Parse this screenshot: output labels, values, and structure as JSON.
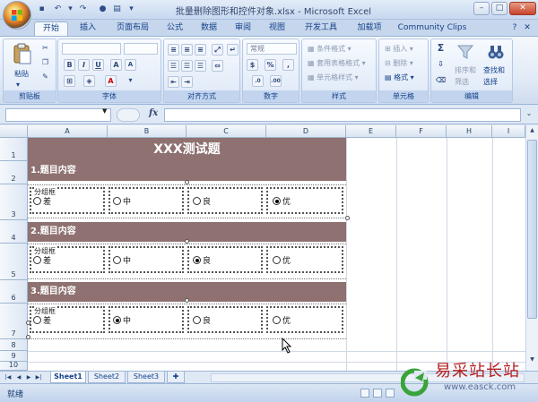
{
  "window": {
    "title": "批量删除图形和控件对象.xlsx - Microsoft Excel",
    "minimize_glyph": "–",
    "maximize_glyph": "□",
    "close_glyph": "✕"
  },
  "ribbon_tabs": [
    "开始",
    "插入",
    "页面布局",
    "公式",
    "数据",
    "审阅",
    "视图",
    "开发工具",
    "加载项",
    "Community Clips"
  ],
  "active_tab": "开始",
  "ribbon": {
    "clipboard": {
      "label": "剪贴板",
      "paste": "粘贴"
    },
    "font": {
      "label": "字体",
      "bold": "B",
      "italic": "I",
      "underline": "U",
      "font_color_glyph": "A"
    },
    "alignment": {
      "label": "对齐方式"
    },
    "number": {
      "label": "数字",
      "format_value": "常规",
      "percent": "%",
      "comma": ","
    },
    "styles": {
      "label": "样式",
      "conditional": "条件格式",
      "table": "套用表格格式",
      "cell_styles": "单元格样式"
    },
    "cells": {
      "label": "单元格",
      "insert": "插入",
      "delete": "删除",
      "format": "格式"
    },
    "editing": {
      "label": "编辑",
      "sum_glyph": "Σ",
      "sort_filter_1": "排序和",
      "sort_filter_2": "筛选",
      "find_select_1": "查找和",
      "find_select_2": "选择"
    }
  },
  "formula_bar": {
    "name_box": "",
    "fx": "fx",
    "formula": ""
  },
  "columns": [
    "A",
    "B",
    "C",
    "D",
    "E",
    "F",
    "H",
    "I"
  ],
  "rows": [
    "1",
    "2",
    "3",
    "4",
    "5",
    "6",
    "7",
    "8",
    "9",
    "10"
  ],
  "sheet": {
    "title": "XXX测试题",
    "questions": [
      {
        "header": "1.题目内容",
        "group_label": "分组框",
        "options": [
          "差",
          "中",
          "良",
          "优"
        ],
        "selected": 3
      },
      {
        "header": "2.题目内容",
        "group_label": "分组框",
        "options": [
          "差",
          "中",
          "良",
          "优"
        ],
        "selected": 2
      },
      {
        "header": "3.题目内容",
        "group_label": "分组框",
        "options": [
          "差",
          "中",
          "良",
          "优"
        ],
        "selected": 1
      }
    ]
  },
  "sheet_tabs": [
    "Sheet1",
    "Sheet2",
    "Sheet3"
  ],
  "active_sheet": "Sheet1",
  "status": {
    "text": "就绪"
  },
  "watermark": {
    "text": "易采站长站",
    "url": "www.easck.com"
  },
  "colors": {
    "band": "#8e7170",
    "accent": "#15428b"
  }
}
